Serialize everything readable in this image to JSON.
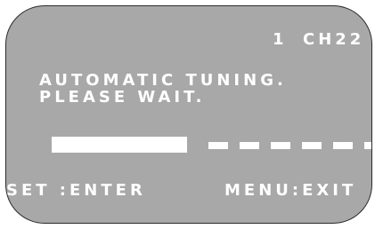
{
  "osd": {
    "channel_number": "1",
    "channel_name": "CH22",
    "message_line1": "AUTOMATIC TUNING.",
    "message_line2": "PLEASE WAIT.",
    "set_hint": "SET :ENTER",
    "exit_hint": "MENU:EXIT"
  },
  "progress": {
    "fraction": 0.42
  },
  "colors": {
    "screen_background": "#a8a8a8",
    "text": "#ffffff"
  }
}
